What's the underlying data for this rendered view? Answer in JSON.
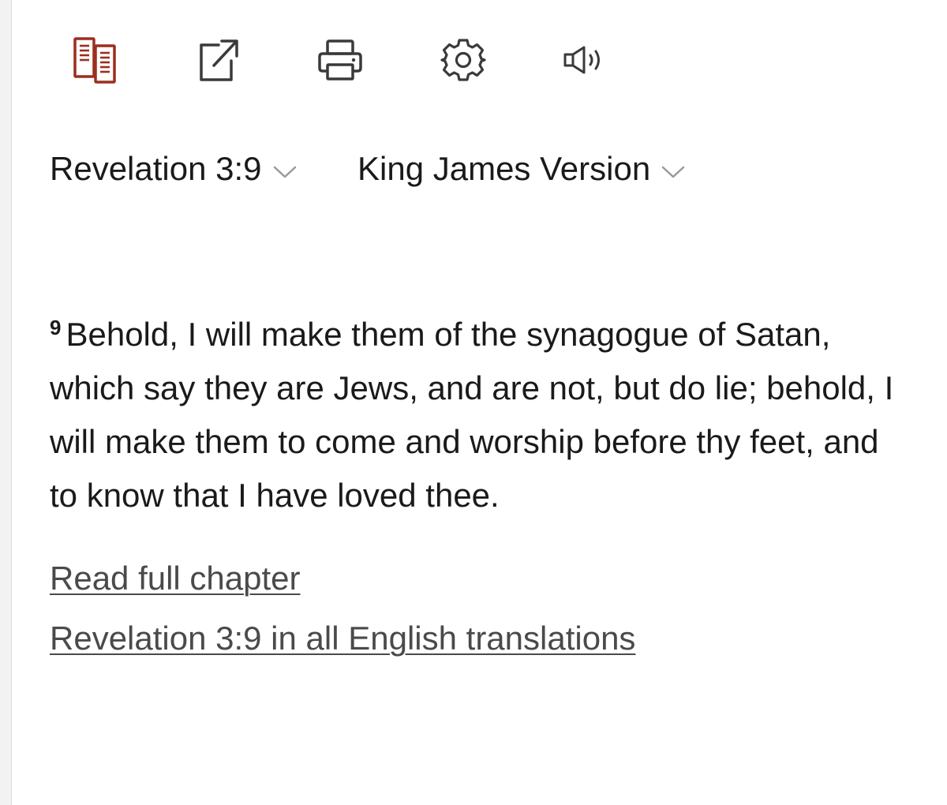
{
  "toolbar": {
    "icons": [
      {
        "name": "parallel-view-icon",
        "color": "#9b2f1e"
      },
      {
        "name": "share-icon"
      },
      {
        "name": "print-icon"
      },
      {
        "name": "settings-gear-icon"
      },
      {
        "name": "audio-speaker-icon"
      }
    ]
  },
  "passage_selector": {
    "reference": "Revelation 3:9",
    "version": "King James Version"
  },
  "verse": {
    "number": "9",
    "text": "Behold, I will make them of the synagogue of Satan, which say they are Jews, and are not, but do lie; behold, I will make them to come and worship before thy feet, and to know that I have loved thee."
  },
  "links": {
    "read_full_chapter": "Read full chapter",
    "all_translations": "Revelation 3:9 in all English translations"
  },
  "colors": {
    "accent": "#9b2f1e",
    "text": "#1a1a1a",
    "link": "#4a4a4a",
    "icon": "#3a3a3a",
    "chevron": "#9a9a9a"
  }
}
